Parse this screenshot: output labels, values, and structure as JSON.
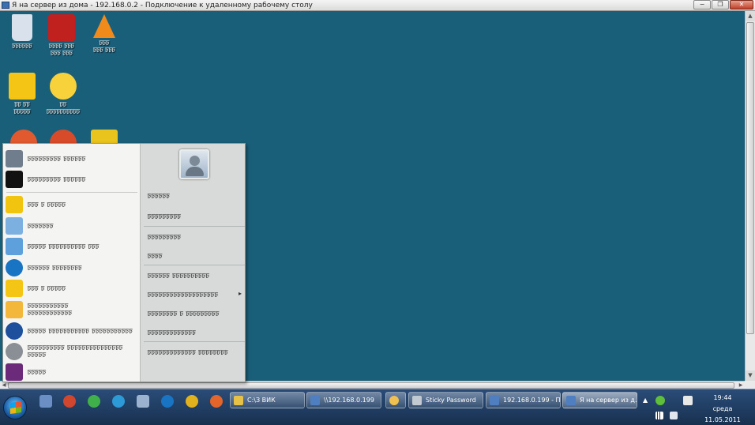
{
  "rdp": {
    "title": "Я на сервер из дома - 192.168.0.2 - Подключение к удаленному рабочему столу",
    "minimize": "−",
    "restore": "❐",
    "close": "✕"
  },
  "desktop_icons": [
    {
      "name": "recycle-bin",
      "label": "ꠑꠑꠑꠑꠑꠑ",
      "color": "#d9e2ec"
    },
    {
      "name": "acrobat",
      "label": "ꠑꠑꠑꠑ ꠑꠑꠑ\nꠑꠑꠑ ꠑꠑꠑ",
      "color": "#c0201e"
    },
    {
      "name": "vlc",
      "label": "ꠑꠑꠑ\nꠑꠑꠑ ꠑꠑꠑ",
      "color": "#f08a1a"
    },
    {
      "name": "1c-v8",
      "label": "ꠑꠑ ꠑꠑ\nꠑꠑꠑꠑꠑ",
      "color": "#f5c515"
    },
    {
      "name": "1c-app",
      "label": "ꠑꠑ\nꠑꠑꠑꠑꠑꠑꠑꠑꠑꠑ",
      "color": "#f8d23a"
    },
    {
      "name": "app-a",
      "label": "",
      "color": "#e15a2f"
    },
    {
      "name": "app-b",
      "label": "",
      "color": "#d84b2a"
    },
    {
      "name": "app-c",
      "label": "",
      "color": "#e8c41c"
    }
  ],
  "start_menu": {
    "left_items": [
      {
        "label": "ꠑꠑꠑꠑꠑꠑꠑꠑꠑ ꠑꠑꠑꠑꠑꠑ",
        "color": "#6f7d8c"
      },
      {
        "label": "ꠑꠑꠑꠑꠑꠑꠑꠑꠑ ꠑꠑꠑꠑꠑꠑ",
        "color": "#111111"
      },
      {
        "label": "ꠑꠑꠑ ꠑ ꠑꠑꠑꠑꠑ",
        "color": "#f1c40f"
      },
      {
        "label": "ꠑꠑꠑꠑꠑꠑꠑ",
        "color": "#7cb0e0"
      },
      {
        "label": "ꠑꠑꠑꠑꠑ ꠑꠑꠑꠑꠑꠑꠑꠑꠑꠑ ꠑꠑꠑ",
        "color": "#5ea0dc"
      },
      {
        "label": "ꠑꠑꠑꠑꠑꠑ ꠑꠑꠑꠑꠑꠑꠑꠑ",
        "color": "#1a74c4"
      },
      {
        "label": "ꠑꠑꠑ ꠑ ꠑꠑꠑꠑꠑ",
        "color": "#f5c515"
      },
      {
        "label": "ꠑꠑꠑꠑꠑꠑꠑꠑꠑꠑꠑ\nꠑꠑꠑꠑꠑꠑꠑꠑꠑꠑꠑꠑ",
        "color": "#f2b73b"
      },
      {
        "label": "ꠑꠑꠑꠑꠑ ꠑꠑꠑꠑꠑꠑꠑꠑꠑꠑꠑ ꠑꠑꠑꠑꠑꠑꠑꠑꠑꠑꠑ",
        "color": "#1d4f9c"
      },
      {
        "label": "ꠑꠑꠑꠑꠑꠑꠑꠑꠑꠑ ꠑꠑꠑꠑꠑꠑꠑꠑꠑꠑꠑꠑꠑꠑꠑ ꠑꠑꠑꠑꠑ",
        "color": "#8a8f96"
      },
      {
        "label": "ꠑꠑꠑꠑꠑ",
        "color": "#6b2a7a"
      }
    ],
    "right_links": [
      "ꠑꠑꠑꠑꠑꠑ",
      "ꠑꠑꠑꠑꠑꠑꠑꠑꠑ",
      "ꠑꠑꠑꠑꠑꠑꠑꠑꠑ",
      "ꠑꠑꠑꠑ",
      "ꠑꠑꠑꠑꠑꠑ ꠑꠑꠑꠑꠑꠑꠑꠑꠑꠑ",
      "ꠑꠑꠑꠑꠑꠑꠑꠑꠑꠑꠑꠑꠑꠑꠑꠑꠑꠑꠑ",
      "ꠑꠑꠑꠑꠑꠑꠑꠑ ꠑ ꠑꠑꠑꠑꠑꠑꠑꠑꠑ",
      "ꠑꠑꠑꠑꠑꠑꠑꠑꠑꠑꠑꠑꠑ",
      "ꠑꠑꠑꠑꠑꠑꠑꠑꠑꠑꠑꠑꠑ ꠑꠑꠑꠑꠑꠑꠑꠑ"
    ],
    "submenu_arrow": "▸"
  },
  "taskbar": {
    "quick_launch": [
      {
        "name": "show-desktop",
        "color": "#6b8fc4"
      },
      {
        "name": "app-red",
        "color": "#d0462e"
      },
      {
        "name": "app-green",
        "color": "#3fb04a"
      },
      {
        "name": "app-blue",
        "color": "#2c9ad6"
      },
      {
        "name": "app-doc",
        "color": "#9cb3cf"
      },
      {
        "name": "internet-explorer",
        "color": "#1a74c4"
      },
      {
        "name": "chrome",
        "color": "#e0b21d"
      },
      {
        "name": "firefox",
        "color": "#e4652a"
      }
    ],
    "buttons": [
      {
        "label": "C:\\З ВИК",
        "color": "#e6c347"
      },
      {
        "label": "\\\\192.168.0.199",
        "color": "#4f7fc0"
      },
      {
        "label": "",
        "color": "#f0c050"
      },
      {
        "label": "Sticky Password",
        "color": "#c3c9d1"
      },
      {
        "label": "192.168.0.199 - П...",
        "color": "#4f7fc0"
      },
      {
        "label": "Я на сервер из д...",
        "color": "#4f7fc0"
      }
    ],
    "tray_up": "▲",
    "clock": {
      "time": "19:44",
      "day": "среда",
      "date": "11.05.2011"
    }
  }
}
